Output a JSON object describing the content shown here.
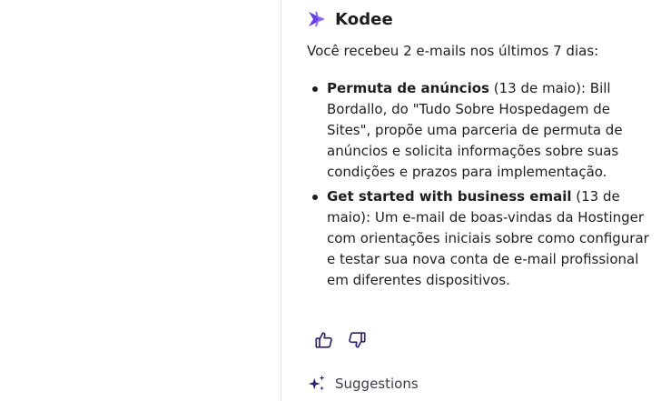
{
  "assistant": {
    "name": "Kodee",
    "brand_color": "#673de6"
  },
  "message": {
    "intro": "Você recebeu 2 e-mails nos últimos 7 dias:",
    "emails": [
      {
        "subject": "Permuta de anúncios",
        "date": "(13 de maio)",
        "summary": ": Bill Bordallo, do \"Tudo Sobre Hospedagem de Sites\", propõe uma parceria de permuta de anúncios e solicita informações sobre suas condições e prazos para implementação."
      },
      {
        "subject": "Get started with business email",
        "date": "(13 de maio)",
        "summary": ": Um e-mail de boas-vindas da Hostinger com orientações iniciais sobre como configurar e testar sua nova conta de e-mail profissional em diferentes dispositivos."
      }
    ]
  },
  "feedback": {
    "like_icon": "thumbs-up-icon",
    "dislike_icon": "thumbs-down-icon"
  },
  "suggestions": {
    "label": "Suggestions",
    "icon": "sparkle-icon"
  }
}
